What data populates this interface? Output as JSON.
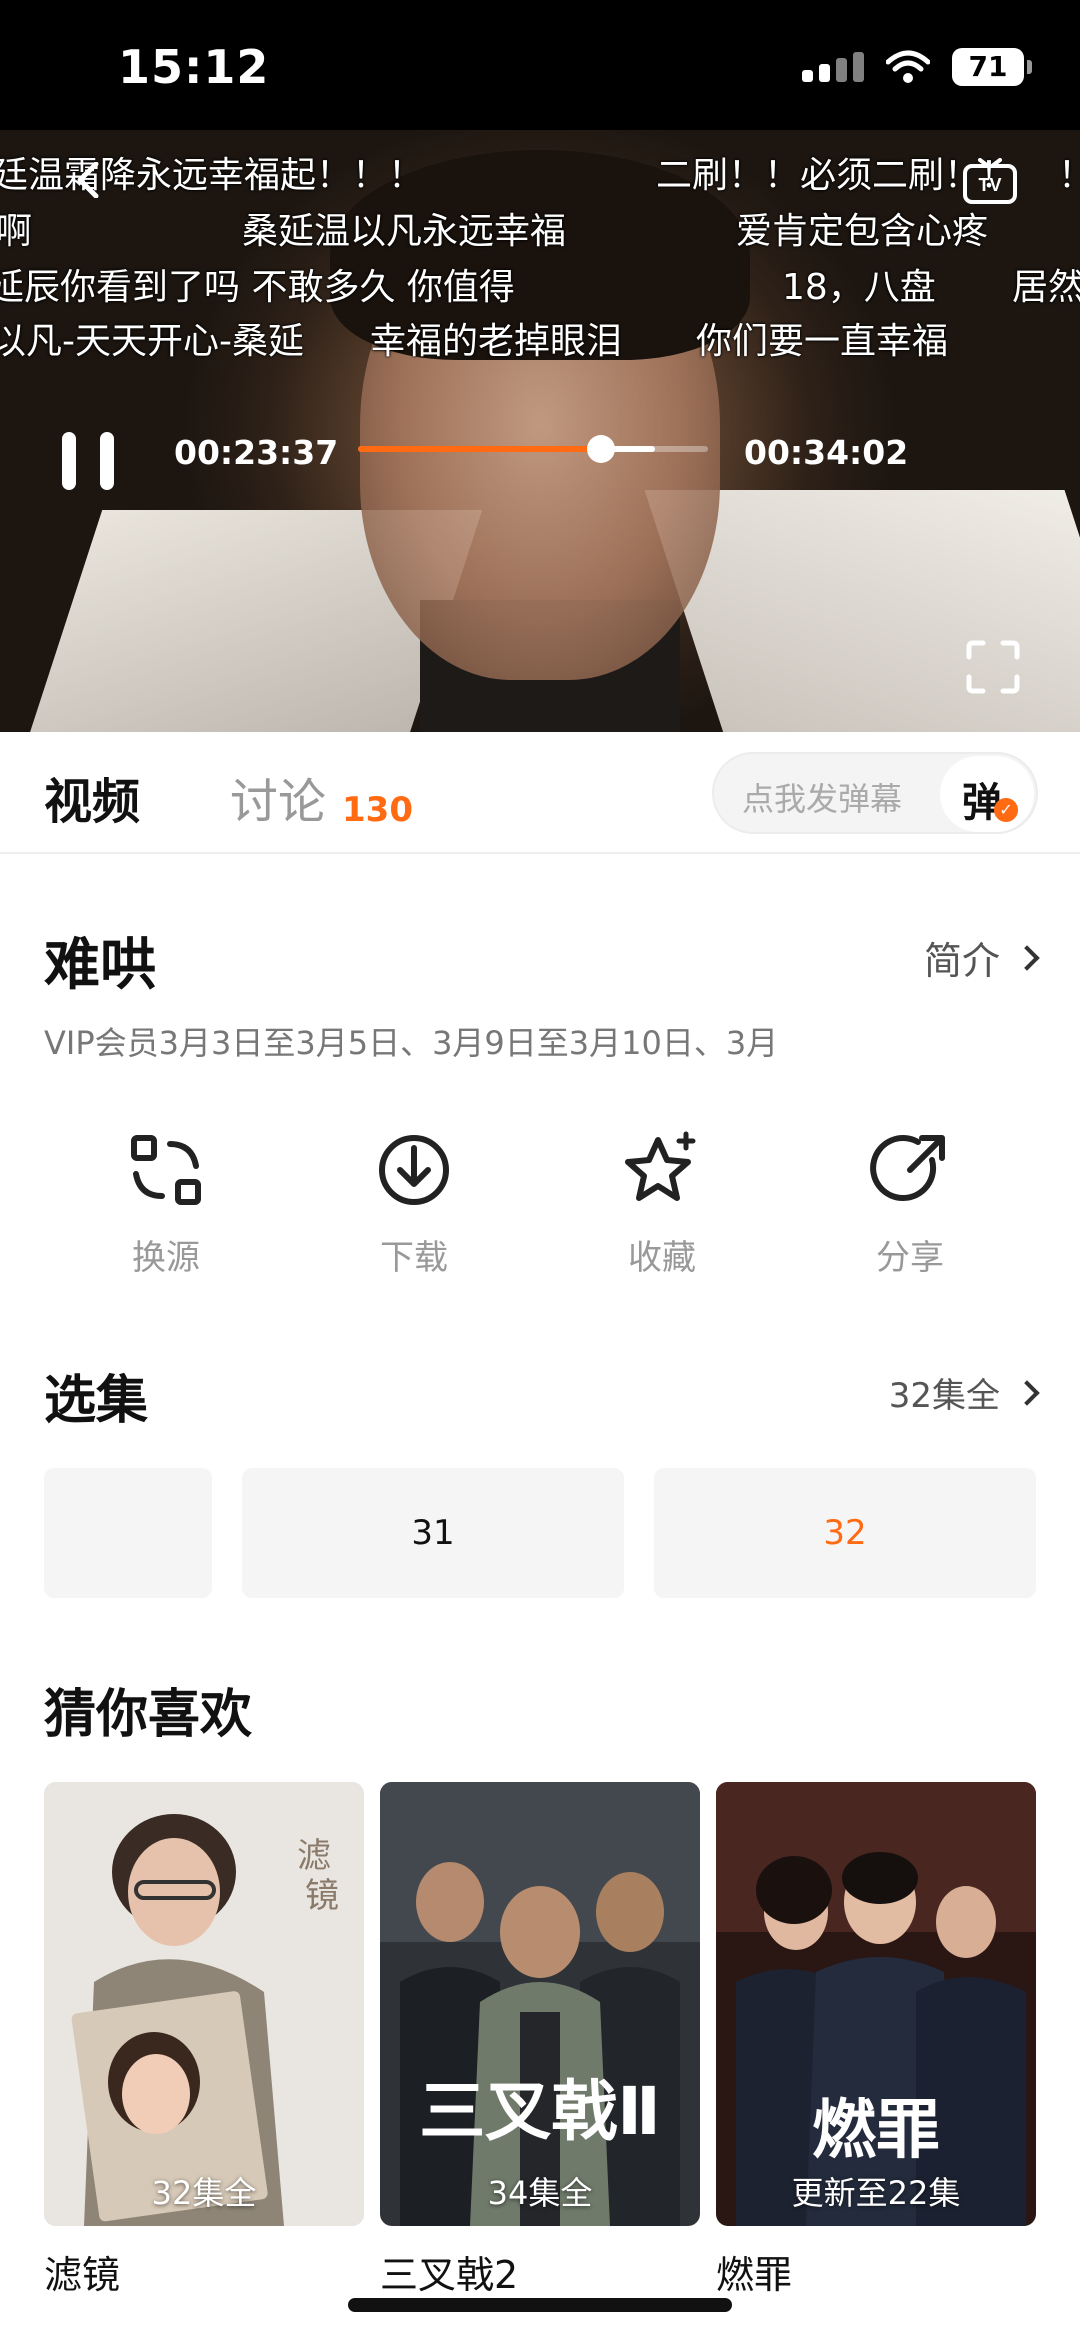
{
  "status_bar": {
    "time": "15:12",
    "battery": "71"
  },
  "player": {
    "danmaku": [
      [
        "廷温霜降永远幸福起！！！",
        "二刷！！必须二刷！！",
        "！"
      ],
      [
        "啊",
        "桑延温以凡永远幸福",
        "爱肯定包含心疼"
      ],
      [
        "延辰你看到了吗 不敢多久 你值得",
        "18，八盘",
        "居然"
      ],
      [
        "以凡-天天开心-桑延",
        "幸福的老掉眼泪",
        "你们要一直幸福"
      ]
    ],
    "current_time": "00:23:37",
    "total_time": "00:34:02",
    "progress_fraction": 0.6944,
    "buffered_fraction": 0.85
  },
  "tabs": {
    "video": "视频",
    "discuss": "讨论",
    "discuss_count": "130"
  },
  "danmaku_input": {
    "placeholder": "点我发弹幕",
    "button": "弹"
  },
  "show": {
    "title": "难哄",
    "intro_link": "简介",
    "schedule": "VIP会员3月3日至3月5日、3月9日至3月10日、3月"
  },
  "actions": [
    {
      "label": "换源",
      "icon": "switch-source-icon"
    },
    {
      "label": "下载",
      "icon": "download-icon"
    },
    {
      "label": "收藏",
      "icon": "favorite-star-icon"
    },
    {
      "label": "分享",
      "icon": "share-icon"
    }
  ],
  "episodes": {
    "title": "选集",
    "count": "32集全",
    "items": [
      "",
      "31",
      "32"
    ],
    "selected": "32",
    "accent": "#ff6a13"
  },
  "recommendations": {
    "title": "猜你喜欢",
    "items": [
      {
        "name": "滤镜",
        "badge": "32集全",
        "poster_text": "滤镜"
      },
      {
        "name": "三叉戟2",
        "badge": "34集全",
        "poster_text": "三叉戟Ⅱ"
      },
      {
        "name": "燃罪",
        "badge": "更新至22集",
        "poster_text": "燃罪"
      }
    ]
  }
}
